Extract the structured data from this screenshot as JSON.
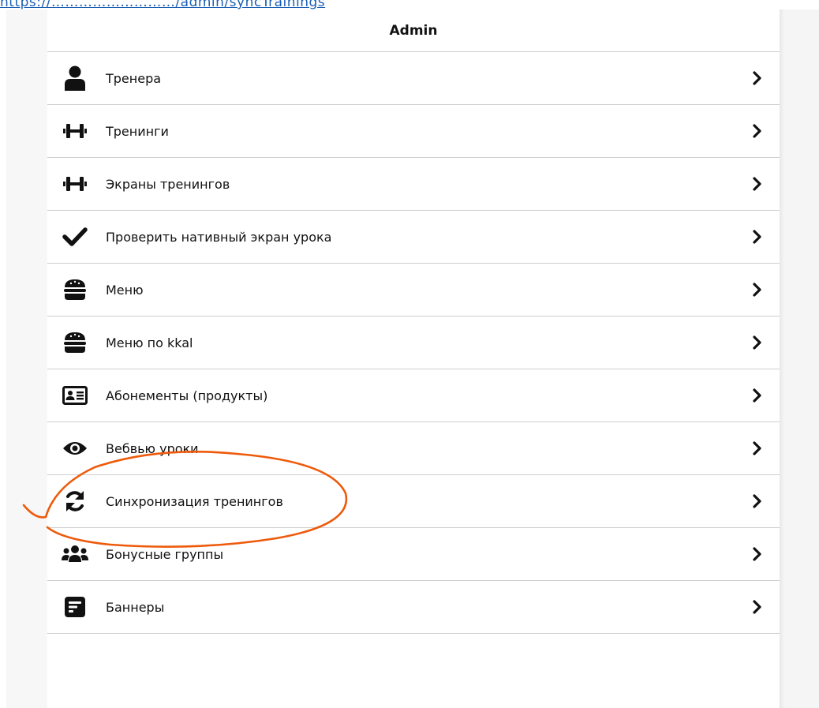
{
  "top_link": "https://………………………/admin/syncTrainings",
  "header": {
    "title": "Admin"
  },
  "menu": {
    "items": [
      {
        "label": "Тренера",
        "icon": "user-icon"
      },
      {
        "label": "Тренинги",
        "icon": "dumbbell-icon"
      },
      {
        "label": "Экраны тренингов",
        "icon": "dumbbell-icon"
      },
      {
        "label": "Проверить нативный экран урока",
        "icon": "check-icon"
      },
      {
        "label": "Меню",
        "icon": "burger-icon"
      },
      {
        "label": "Меню по kkal",
        "icon": "burger-icon"
      },
      {
        "label": "Абонементы (продукты)",
        "icon": "id-card-icon"
      },
      {
        "label": "Вебвью уроки",
        "icon": "eye-icon"
      },
      {
        "label": "Синхронизация тренингов",
        "icon": "sync-icon"
      },
      {
        "label": "Бонусные группы",
        "icon": "users-icon"
      },
      {
        "label": "Баннеры",
        "icon": "banner-icon"
      }
    ]
  },
  "colors": {
    "annotation": "#ee5a0b",
    "link": "#1a5fb4",
    "divider": "#cfcfcf"
  }
}
